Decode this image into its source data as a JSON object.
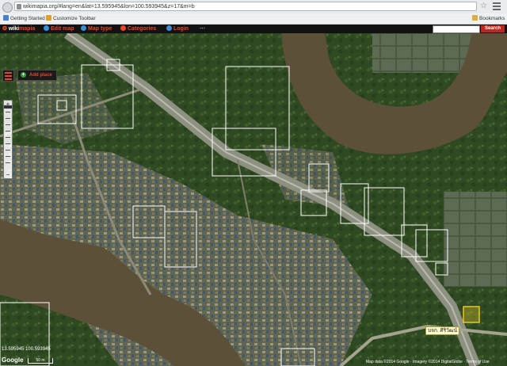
{
  "browser": {
    "url": "wikimapia.org/#lang=en&lat=13.595945&lon=100.593945&z=17&m=b",
    "bookmarks": [
      {
        "label": "Getting Started",
        "color": "#4a7fd0"
      },
      {
        "label": "Customize Toolbar",
        "color": "#e0a020"
      }
    ],
    "right_bookmark": "Bookmarks"
  },
  "toolbar": {
    "logo_prefix": "wiki",
    "logo_suffix": "mapia",
    "items": [
      {
        "label": "Edit map",
        "icon": "globe-icon",
        "color": "#3a8fd8"
      },
      {
        "label": "Map type",
        "icon": "map-type-icon",
        "color": "#3a8fd8"
      },
      {
        "label": "Categories",
        "icon": "categories-icon",
        "color": "#e8452c"
      },
      {
        "label": "Login",
        "icon": "user-icon",
        "color": "#3a8fd8"
      }
    ],
    "search_button": "Search"
  },
  "map": {
    "add_place_label": "Add place",
    "poi_label": "บจก. ศิริวัฒน์",
    "coordinates": "13.595945 100.593945",
    "google": "Google",
    "scale": "50 m",
    "attribution": "Map data ©2014 Google · Imagery ©2014 DigitalGlobe · Terms of Use"
  }
}
